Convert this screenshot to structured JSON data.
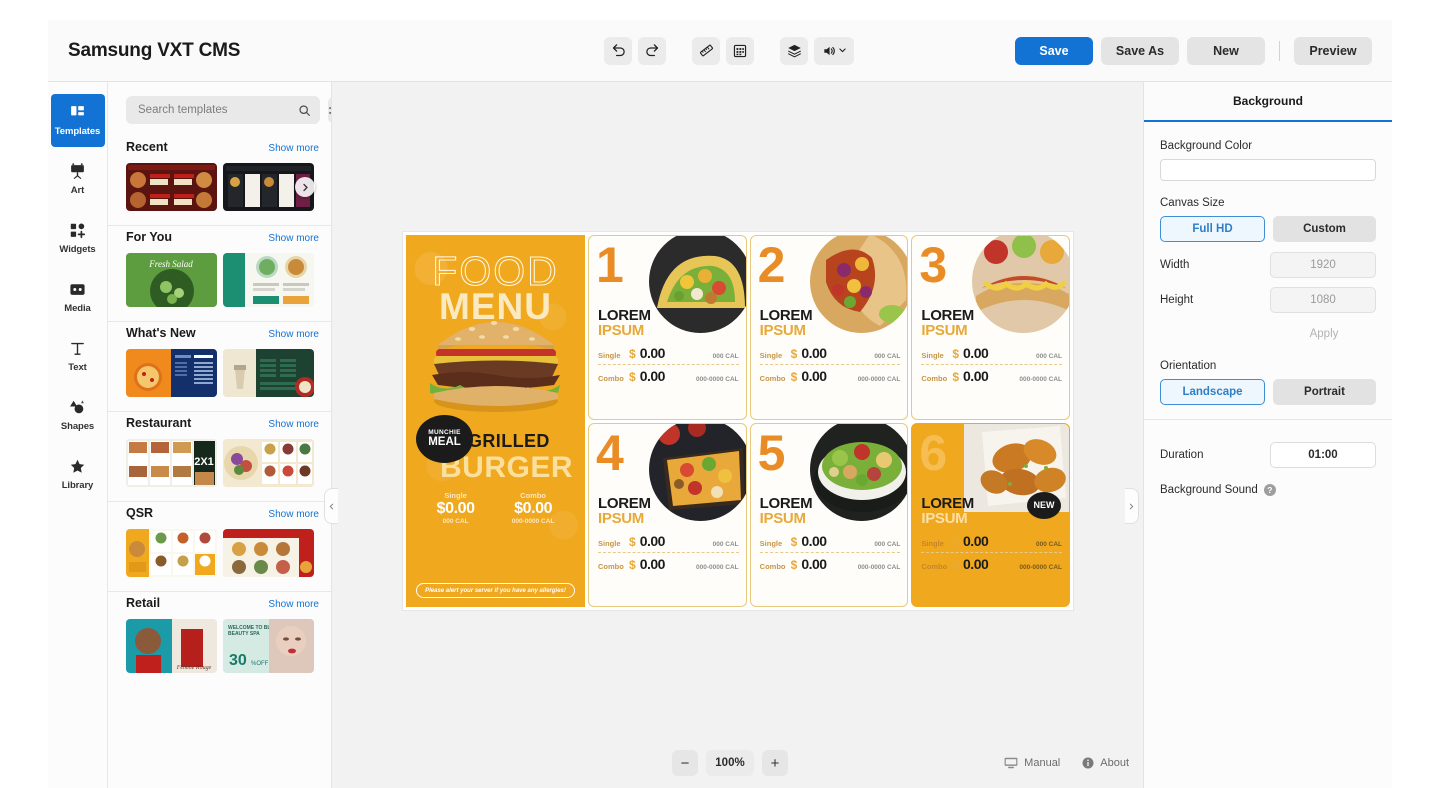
{
  "app": {
    "title": "Samsung VXT CMS"
  },
  "toolbar": {
    "undo": "undo-icon",
    "redo": "redo-icon",
    "ruler": "ruler-icon",
    "grid": "grid-icon",
    "layers": "layers-icon",
    "volume": "volume-icon",
    "volume_chevron": "chevron-down-icon"
  },
  "actions": {
    "save": "Save",
    "save_as": "Save As",
    "new": "New",
    "preview": "Preview",
    "primary_color": "#1273d4"
  },
  "rail": {
    "items": [
      {
        "label": "Templates",
        "icon": "templates-icon",
        "active": true
      },
      {
        "label": "Art",
        "icon": "art-icon",
        "active": false
      },
      {
        "label": "Widgets",
        "icon": "widgets-icon",
        "active": false
      },
      {
        "label": "Media",
        "icon": "media-icon",
        "active": false
      },
      {
        "label": "Text",
        "icon": "text-icon",
        "active": false
      },
      {
        "label": "Shapes",
        "icon": "shapes-icon",
        "active": false
      },
      {
        "label": "Library",
        "icon": "library-icon",
        "active": false
      }
    ]
  },
  "templates_panel": {
    "search": {
      "placeholder": "Search templates",
      "value": "",
      "icon": "search-icon"
    },
    "filter_icon": "filter-sliders-icon",
    "show_more": "Show more",
    "sections": [
      {
        "title": "Recent",
        "show_more": "Show more",
        "has_carousel": true
      },
      {
        "title": "For You",
        "show_more": "Show more",
        "has_carousel": false
      },
      {
        "title": "What's New",
        "show_more": "Show more",
        "has_carousel": false
      },
      {
        "title": "Restaurant",
        "show_more": "Show more",
        "has_carousel": false
      },
      {
        "title": "QSR",
        "show_more": "Show more",
        "has_carousel": false
      },
      {
        "title": "Retail",
        "show_more": "Show more",
        "has_carousel": false
      }
    ]
  },
  "canvas": {
    "collapse_left_icon": "chevron-left-icon",
    "collapse_right_icon": "chevron-right-icon",
    "zoom": {
      "value": "100%",
      "minus": "−",
      "plus": "+"
    },
    "manual": "Manual",
    "about": "About",
    "manual_icon": "monitor-icon",
    "about_icon": "info-icon"
  },
  "design": {
    "hero": {
      "line1": "FOOD",
      "line2": "MENU",
      "badge_line1": "MUNCHIE",
      "badge_line2": "MEAL",
      "title_top": "GRILLED",
      "title_bottom": "BURGER",
      "single_label": "Single",
      "single_price": "$0.00",
      "single_cal": "000 CAL",
      "combo_label": "Combo",
      "combo_price": "$0.00",
      "combo_cal": "000-0000 CAL",
      "note": "Please alert your server if you have any allergies!",
      "bg_color": "#f0a81e"
    },
    "cards": [
      {
        "number": "1",
        "title_top": "LOREM",
        "title_bottom": "IPSUM",
        "single_label": "Single",
        "single_currency": "$",
        "single_price": "0.00",
        "single_cal": "000 CAL",
        "combo_label": "Combo",
        "combo_currency": "$",
        "combo_price": "0.00",
        "combo_cal": "000-0000 CAL",
        "style": "light",
        "badge": ""
      },
      {
        "number": "2",
        "title_top": "LOREM",
        "title_bottom": "IPSUM",
        "single_label": "Single",
        "single_currency": "$",
        "single_price": "0.00",
        "single_cal": "000 CAL",
        "combo_label": "Combo",
        "combo_currency": "$",
        "combo_price": "0.00",
        "combo_cal": "000-0000 CAL",
        "style": "light",
        "badge": ""
      },
      {
        "number": "3",
        "title_top": "LOREM",
        "title_bottom": "IPSUM",
        "single_label": "Single",
        "single_currency": "$",
        "single_price": "0.00",
        "single_cal": "000 CAL",
        "combo_label": "Combo",
        "combo_currency": "$",
        "combo_price": "0.00",
        "combo_cal": "000-0000 CAL",
        "style": "light",
        "badge": ""
      },
      {
        "number": "4",
        "title_top": "LOREM",
        "title_bottom": "IPSUM",
        "single_label": "Single",
        "single_currency": "$",
        "single_price": "0.00",
        "single_cal": "000 CAL",
        "combo_label": "Combo",
        "combo_currency": "$",
        "combo_price": "0.00",
        "combo_cal": "000-0000 CAL",
        "style": "light",
        "badge": ""
      },
      {
        "number": "5",
        "title_top": "LOREM",
        "title_bottom": "IPSUM",
        "single_label": "Single",
        "single_currency": "$",
        "single_price": "0.00",
        "single_cal": "000 CAL",
        "combo_label": "Combo",
        "combo_currency": "$",
        "combo_price": "0.00",
        "combo_cal": "000-0000 CAL",
        "style": "light",
        "badge": ""
      },
      {
        "number": "6",
        "title_top": "LOREM",
        "title_bottom": "IPSUM",
        "single_label": "Single",
        "single_currency": "$",
        "single_price": "0.00",
        "single_cal": "000 CAL",
        "combo_label": "Combo",
        "combo_currency": "$",
        "combo_price": "0.00",
        "combo_cal": "000-0000 CAL",
        "style": "orange",
        "badge": "NEW"
      }
    ]
  },
  "right_panel": {
    "tab": "Background",
    "background_color_label": "Background Color",
    "background_color_value": "#ffffff",
    "canvas_size_label": "Canvas Size",
    "full_hd": "Full HD",
    "custom": "Custom",
    "width_label": "Width",
    "width_value": "1920",
    "height_label": "Height",
    "height_value": "1080",
    "apply": "Apply",
    "orientation_label": "Orientation",
    "landscape": "Landscape",
    "portrait": "Portrait",
    "duration_label": "Duration",
    "duration_value": "01:00",
    "background_sound_label": "Background Sound",
    "help_icon": "help-icon",
    "accent": "#3e8fd6"
  }
}
